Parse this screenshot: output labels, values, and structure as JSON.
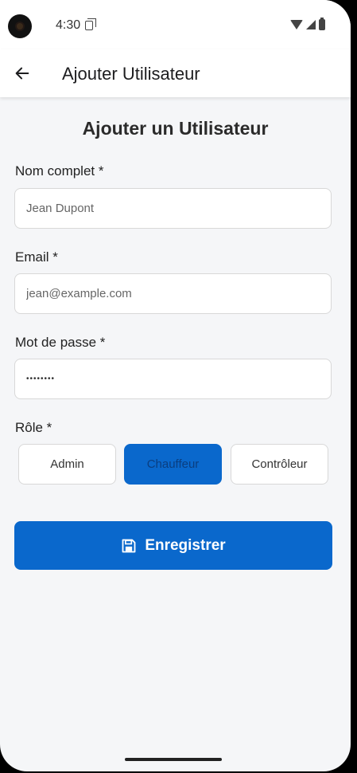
{
  "status_bar": {
    "time": "4:30"
  },
  "app_bar": {
    "back_icon": "arrow-left-icon",
    "title": "Ajouter Utilisateur"
  },
  "form": {
    "title": "Ajouter un Utilisateur",
    "name": {
      "label": "Nom complet *",
      "placeholder": "Jean Dupont"
    },
    "email": {
      "label": "Email *",
      "placeholder": "jean@example.com"
    },
    "password": {
      "label": "Mot de passe *",
      "value": "••••••••"
    },
    "role": {
      "label": "Rôle *",
      "options": [
        "Admin",
        "Chauffeur",
        "Contrôleur"
      ],
      "selected": "Chauffeur"
    },
    "save_button": {
      "icon": "floppy-disk-icon",
      "label": "Enregistrer"
    }
  },
  "colors": {
    "accent": "#0a68cc",
    "background": "#f5f6f8"
  }
}
